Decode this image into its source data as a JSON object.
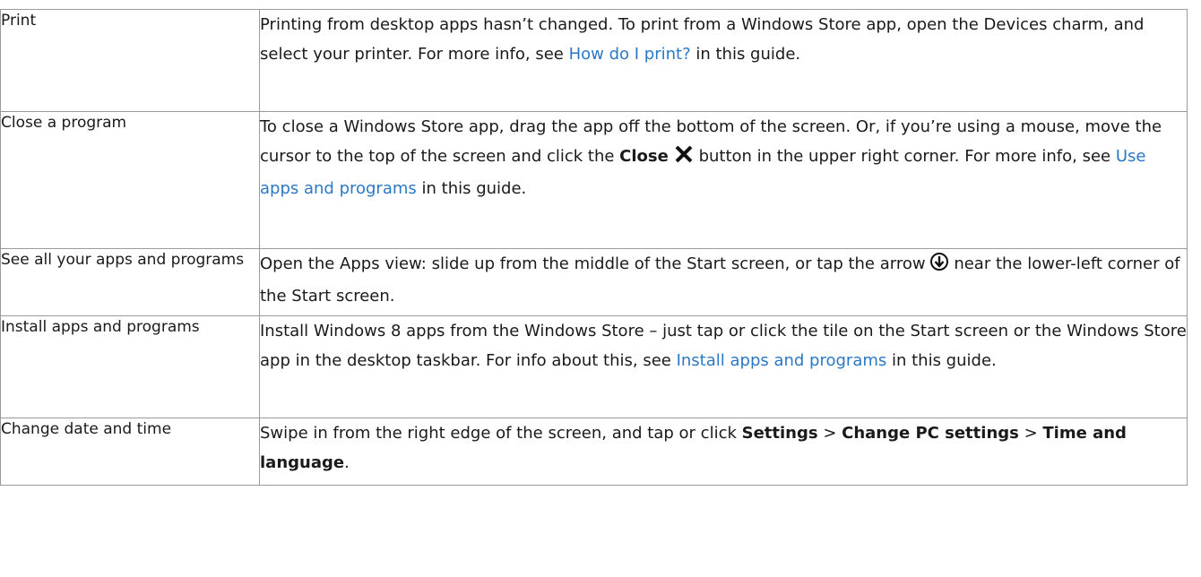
{
  "rows": [
    {
      "topic": "Print",
      "desc": {
        "text1": "Printing from desktop apps hasn’t changed. To print from a Windows Store app, open the Devices charm, and select your printer. For more info, see ",
        "link": "How do I print?",
        "text2": " in this guide."
      }
    },
    {
      "topic": "Close a program",
      "desc": {
        "text1": "To close a Windows Store app, drag the app off the bottom of the screen. Or, if you’re using a mouse, move the cursor to the top of the screen and click the ",
        "bold": "Close",
        "text2": " button in the upper right corner. For more info, see ",
        "link": "Use apps and programs",
        "text3": " in this guide."
      }
    },
    {
      "topic": "See all your apps and programs",
      "desc": {
        "text1": "Open the Apps view: slide up from the middle of the Start screen, or tap the arrow",
        "text2": " near the lower-left corner of the Start screen."
      }
    },
    {
      "topic": "Install apps and programs",
      "desc": {
        "text1": "Install Windows 8 apps from the Windows Store – just tap or click the tile on the Start screen or the Windows Store app in the desktop taskbar. For info about this, see ",
        "link": "Install apps and programs",
        "text2": " in this guide."
      }
    },
    {
      "topic": "Change date and time",
      "desc": {
        "text1": "Swipe in from the right edge of the screen, and tap or click ",
        "bold1": "Settings",
        "sep1": " > ",
        "bold2": "Change PC settings",
        "sep2": " > ",
        "bold3": "Time and language",
        "end": "."
      }
    }
  ],
  "colors": {
    "link": "#2b78c5",
    "border": "#9a9a9a"
  },
  "icons": {
    "close": "close-x-icon",
    "apps_arrow": "down-arrow-circle-icon"
  }
}
